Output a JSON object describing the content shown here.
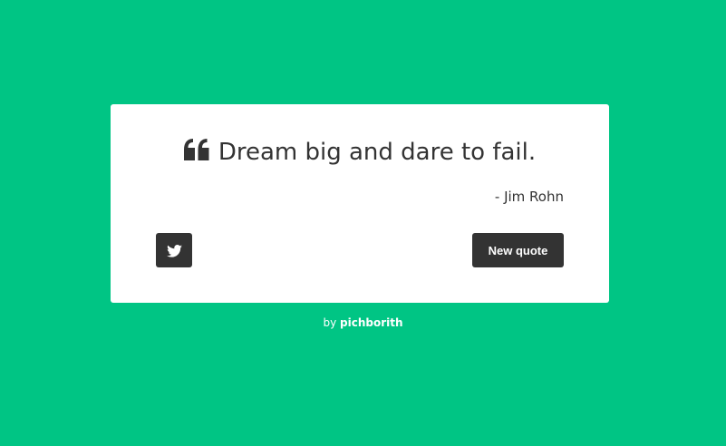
{
  "colors": {
    "background": "#00c584",
    "card": "#ffffff",
    "text": "#333333",
    "button": "#333333",
    "button_text": "#ffffff"
  },
  "quote": {
    "icon": "quote-left-icon",
    "text": "Dream big and dare to fail.",
    "author": "- Jim Rohn"
  },
  "actions": {
    "tweet_icon": "twitter-icon",
    "new_quote_label": "New quote"
  },
  "footer": {
    "prefix": "by",
    "link_text": "pichborith"
  }
}
